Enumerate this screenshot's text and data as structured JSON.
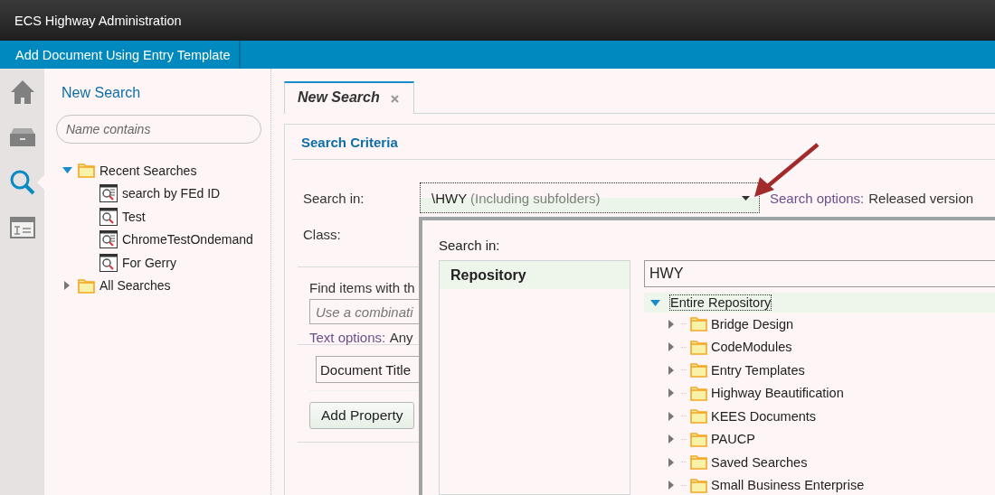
{
  "app": {
    "title": "ECS Highway Administration"
  },
  "action_bar": {
    "items": [
      {
        "label": "Add Document Using Entry Template"
      }
    ]
  },
  "nav_rail": {
    "items": [
      {
        "kind": "home",
        "selected": false
      },
      {
        "kind": "cabinet",
        "selected": false
      },
      {
        "kind": "search",
        "selected": true
      },
      {
        "kind": "form",
        "selected": false
      }
    ]
  },
  "search_pane": {
    "title": "New Search",
    "filter": {
      "placeholder": "Name contains"
    },
    "tree": [
      {
        "label": "Recent Searches",
        "expanded": true,
        "children": [
          {
            "label": "search by FEd ID",
            "kind": "text_search"
          },
          {
            "label": "Test",
            "kind": "search"
          },
          {
            "label": "ChromeTestOndemand",
            "kind": "text_search"
          },
          {
            "label": "For Gerry",
            "kind": "search"
          }
        ]
      },
      {
        "label": "All Searches",
        "expanded": false
      }
    ]
  },
  "tabs": [
    {
      "label": "New Search",
      "selected": true
    }
  ],
  "criteria": {
    "title": "Search Criteria",
    "search_in": {
      "label": "Search in:",
      "value": "\\HWY",
      "hint": "(Including subfolders)"
    },
    "search_options": {
      "label": "Search options:",
      "value": "Released version"
    },
    "class": {
      "label": "Class:"
    },
    "text_search": {
      "label": "Find items with th",
      "placeholder": "Use a combinati",
      "options_label": "Text options:",
      "options_value": "Any"
    },
    "property": {
      "value": "Document Title"
    },
    "add_property": {
      "label": "Add Property"
    }
  },
  "popup": {
    "title": "Search in:",
    "sources": [
      {
        "label": "Repository",
        "selected": true
      }
    ],
    "filter_value": "HWY",
    "tree": {
      "label": "Entire Repository",
      "expanded": true,
      "selected": true,
      "children": [
        {
          "label": "Bridge Design",
          "expanded": false
        },
        {
          "label": "CodeModules",
          "expanded": false
        },
        {
          "label": "Entry Templates",
          "expanded": false
        },
        {
          "label": "Highway Beautification",
          "expanded": false
        },
        {
          "label": "KEES Documents",
          "expanded": false
        },
        {
          "label": "PAUCP",
          "expanded": false
        },
        {
          "label": "Saved Searches",
          "expanded": false
        },
        {
          "label": "Small Business Enterprise",
          "expanded": false
        }
      ]
    }
  }
}
